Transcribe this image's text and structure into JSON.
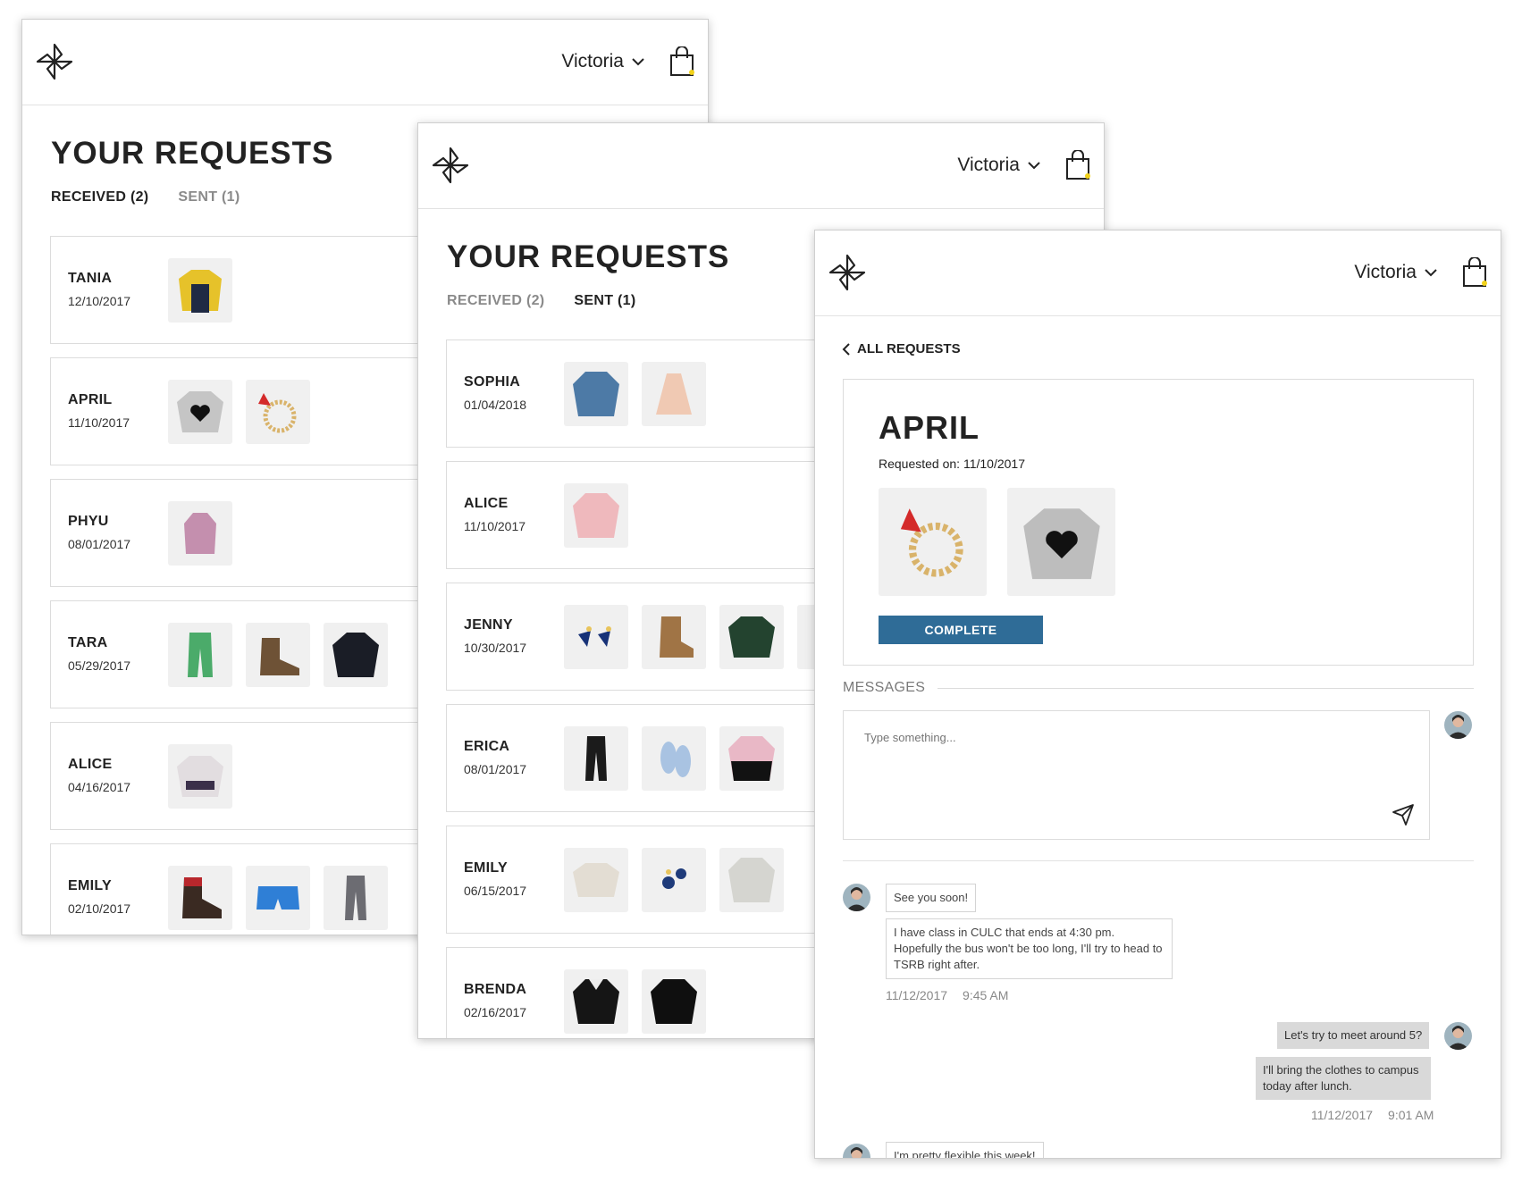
{
  "header": {
    "user_name": "Victoria"
  },
  "page_title": "YOUR REQUESTS",
  "tabs": {
    "received": "RECEIVED (2)",
    "sent": "SENT (1)"
  },
  "received_requests": [
    {
      "name": "TANIA",
      "date": "12/10/2017",
      "items": [
        "yellow-jacket"
      ]
    },
    {
      "name": "APRIL",
      "date": "11/10/2017",
      "items": [
        "heart-sweater",
        "bead-bracelet"
      ]
    },
    {
      "name": "PHYU",
      "date": "08/01/2017",
      "items": [
        "pink-top"
      ]
    },
    {
      "name": "TARA",
      "date": "05/29/2017",
      "items": [
        "green-pants",
        "brown-boots",
        "black-hoodie"
      ]
    },
    {
      "name": "ALICE",
      "date": "04/16/2017",
      "items": [
        "patterned-sweater"
      ]
    },
    {
      "name": "EMILY",
      "date": "02/10/2017",
      "items": [
        "duck-boots",
        "blue-shorts",
        "striped-pants"
      ]
    }
  ],
  "sent_requests": [
    {
      "name": "SOPHIA",
      "date": "01/04/2018",
      "items": [
        "denim-shirt",
        "peach-top"
      ]
    },
    {
      "name": "ALICE",
      "date": "11/10/2017",
      "items": [
        "pink-hoodie"
      ]
    },
    {
      "name": "JENNY",
      "date": "10/30/2017",
      "items": [
        "tassel-earrings",
        "tan-boots",
        "green-top",
        "beige-item"
      ]
    },
    {
      "name": "ERICA",
      "date": "08/01/2017",
      "items": [
        "black-jeans",
        "blue-sneakers",
        "colorblock-sweater"
      ]
    },
    {
      "name": "EMILY",
      "date": "06/15/2017",
      "items": [
        "cream-sweater",
        "blue-earrings",
        "white-hoodie"
      ]
    },
    {
      "name": "BRENDA",
      "date": "02/16/2017",
      "items": [
        "sherpa-jacket",
        "leather-jacket"
      ]
    }
  ],
  "detail": {
    "back_label": "ALL REQUESTS",
    "name": "APRIL",
    "requested_on": "Requested on: 11/10/2017",
    "items": [
      "bead-bracelet",
      "heart-sweater"
    ],
    "complete_label": "COMPLETE",
    "messages_label": "MESSAGES",
    "compose_placeholder": "Type something...",
    "messages": [
      {
        "text": "See you soon!"
      },
      {
        "text": "I have class in CULC that ends at 4:30 pm. Hopefully the bus won't be too long, I'll try to head to TSRB right after."
      },
      {
        "date": "11/12/2017",
        "time": "9:45 AM"
      },
      {
        "text": "Let's try to meet around 5?"
      },
      {
        "text": "I'll bring the clothes to campus today after lunch."
      },
      {
        "date": "11/12/2017",
        "time": "9:01 AM"
      },
      {
        "text": "I'm pretty flexible this week!"
      }
    ]
  },
  "colors": {
    "primary_button": "#2f6c97",
    "badge": "#f2d21a"
  }
}
